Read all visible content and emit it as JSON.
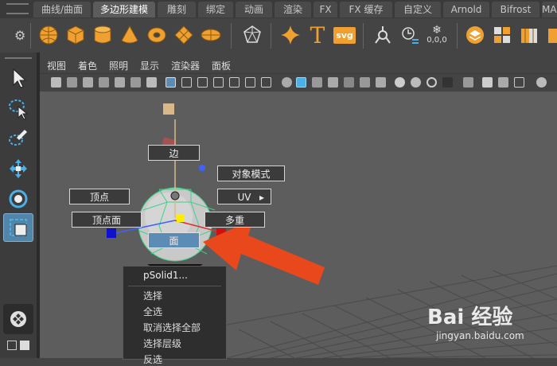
{
  "shelf": {
    "tabs": [
      "曲线/曲面",
      "多边形建模",
      "雕刻",
      "绑定",
      "动画",
      "渲染",
      "FX",
      "FX 缓存",
      "自定义",
      "Arnold",
      "Bifrost",
      "MASH"
    ],
    "active_tab": "多边形建模",
    "svg_label": "svg",
    "text_tool_label": "T",
    "snow_label": "0,0,0"
  },
  "viewport": {
    "menu": [
      "视图",
      "着色",
      "照明",
      "显示",
      "渲染器",
      "面板"
    ]
  },
  "marking_menu": {
    "edge": "边",
    "object_mode": "对象模式",
    "vertex": "顶点",
    "uv": "UV",
    "uv_arrow": "▸",
    "vertex_face": "顶点面",
    "multi": "多重",
    "face": "面"
  },
  "context_menu": {
    "title": "pSolid1...",
    "items": [
      "选择",
      "全选",
      "取消选择全部",
      "选择层级",
      "反选"
    ]
  },
  "watermark": {
    "logo": "Bai 经验",
    "url": "jingyan.baidu.com"
  },
  "colors": {
    "accent": "#5b8cb6",
    "arrow": "#e8481c",
    "shelf_icon": "#f0a030",
    "wire": "#3fd08a"
  }
}
